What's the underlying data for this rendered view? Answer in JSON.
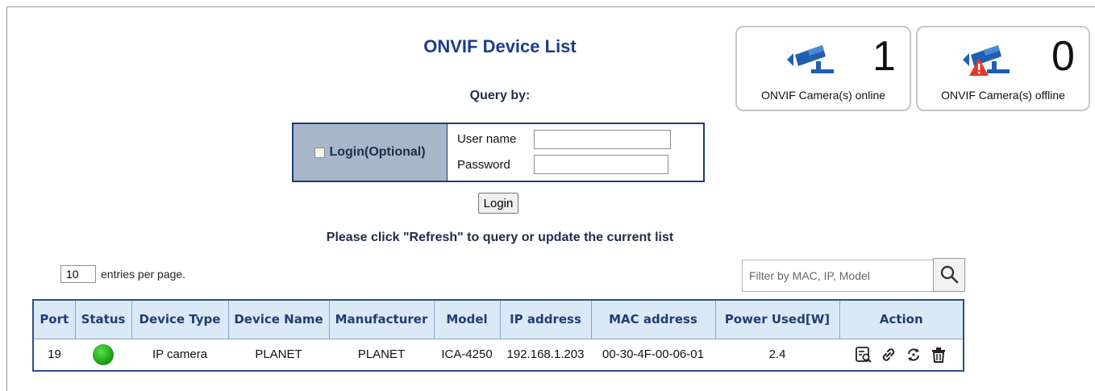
{
  "header": {
    "title": "ONVIF Device List",
    "query_by": "Query by:"
  },
  "login": {
    "checkbox_label": "Login(Optional)",
    "username_label": "User name",
    "password_label": "Password",
    "username_value": "",
    "password_value": "",
    "button_label": "Login"
  },
  "hint": "Please click \"Refresh\" to query or update the current list",
  "cards": {
    "online": {
      "count": "1",
      "label": "ONVIF Camera(s) online",
      "icon": "camera-online-icon"
    },
    "offline": {
      "count": "0",
      "label": "ONVIF Camera(s) offline",
      "icon": "camera-offline-icon"
    }
  },
  "paging": {
    "entries_value": "10",
    "entries_label": "entries per page."
  },
  "filter": {
    "placeholder": "Filter by MAC, IP, Model",
    "value": ""
  },
  "table": {
    "headers": [
      "Port",
      "Status",
      "Device Type",
      "Device Name",
      "Manufacturer",
      "Model",
      "IP address",
      "MAC address",
      "Power Used[W]",
      "Action"
    ],
    "rows": [
      {
        "port": "19",
        "status": "online",
        "device_type": "IP camera",
        "device_name": "PLANET",
        "manufacturer": "PLANET",
        "model": "ICA-4250",
        "ip": "192.168.1.203",
        "mac": "00-30-4F-00-06-01",
        "power": "2.4"
      }
    ]
  },
  "colors": {
    "title": "#1a3c8c",
    "table_header_bg": "#dbe9f7",
    "table_border": "#2c4f85",
    "status_online": "#23a81a",
    "camera_blue": "#1f5fb0",
    "alert_red": "#e23a2a"
  }
}
